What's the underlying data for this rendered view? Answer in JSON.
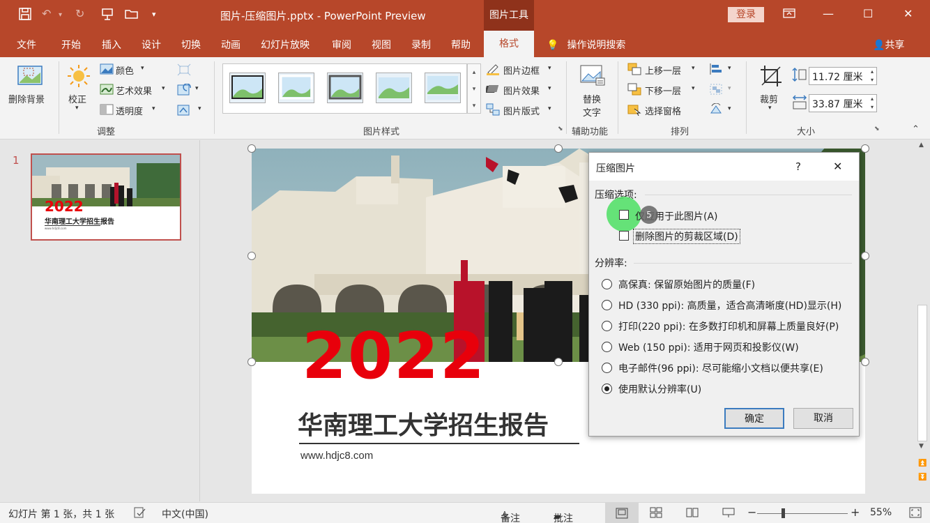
{
  "titlebar": {
    "doc_title": "图片-压缩图片.pptx - PowerPoint Preview",
    "context_tools": "图片工具",
    "login": "登录"
  },
  "tabs": [
    "文件",
    "开始",
    "插入",
    "设计",
    "切换",
    "动画",
    "幻灯片放映",
    "审阅",
    "视图",
    "录制",
    "帮助"
  ],
  "active_tab": "格式",
  "tell_me": "操作说明搜索",
  "share": "共享",
  "ribbon": {
    "remove_bg": "删除背景",
    "correct": "校正",
    "color": "颜色",
    "artistic": "艺术效果",
    "transparency": "透明度",
    "group_adjust": "调整",
    "picture_border": "图片边框",
    "picture_effects": "图片效果",
    "picture_layout": "图片版式",
    "group_styles": "图片样式",
    "alt_text_1": "替换",
    "alt_text_2": "文字",
    "group_accessibility": "辅助功能",
    "bring_forward": "上移一层",
    "send_backward": "下移一层",
    "selection_pane": "选择窗格",
    "group_arrange": "排列",
    "crop": "裁剪",
    "height": "11.72 厘米",
    "width": "33.87 厘米",
    "group_size": "大小"
  },
  "thumbnail": {
    "number": "1",
    "year": "2022",
    "title": "华南理工大学招生报告",
    "url": "www.hdjc8.com"
  },
  "slide": {
    "year": "2022",
    "title": "华南理工大学招生报告",
    "url": "www.hdjc8.com"
  },
  "dialog": {
    "title": "压缩图片",
    "help": "?",
    "close": "✕",
    "section_compress": "压缩选项:",
    "opt_apply_only": "仅应用于此图片(A)",
    "opt_delete_crop": "删除图片的剪裁区域(D)",
    "section_resolution": "分辨率:",
    "resolutions": [
      "高保真: 保留原始图片的质量(F)",
      "HD (330 ppi): 高质量，适合高清晰度(HD)显示(H)",
      "打印(220 ppi): 在多数打印机和屏幕上质量良好(P)",
      "Web (150 ppi): 适用于网页和投影仪(W)",
      "电子邮件(96 ppi): 尽可能缩小文档以便共享(E)",
      "使用默认分辨率(U)"
    ],
    "selected_resolution_index": 5,
    "ok": "确定",
    "cancel": "取消",
    "cursor_badge": "5"
  },
  "statusbar": {
    "slide_info": "幻灯片 第 1 张，共 1 张",
    "language": "中文(中国)",
    "notes": "备注",
    "comments": "批注",
    "zoom": "55%",
    "minus": "−",
    "plus": "+"
  },
  "colors": {
    "accent": "#b7472a",
    "ribbon_bg": "#f3f3f3",
    "slide_year": "#e8000b",
    "highlight": "#55e06a"
  }
}
